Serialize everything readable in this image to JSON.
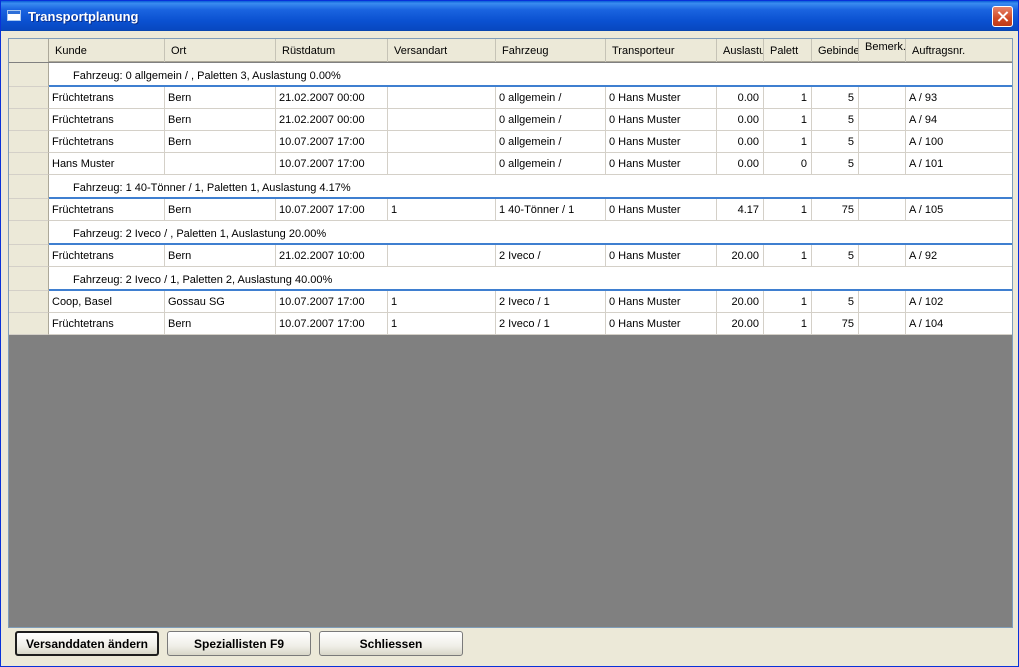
{
  "window": {
    "title": "Transportplanung"
  },
  "columns": [
    "Kunde",
    "Ort",
    "Rüstdatum",
    "Versandart",
    "Fahrzeug",
    "Transporteur",
    "Auslastu",
    "Palett",
    "Gebinde",
    "Bemerk.",
    "Auftragsnr."
  ],
  "groups": [
    {
      "header": "Fahrzeug: 0 allgemein / , Paletten 3, Auslastung 0.00%",
      "rows": [
        [
          "Früchtetrans",
          "Bern",
          "21.02.2007 00:00",
          "",
          "0 allgemein /",
          "0 Hans Muster",
          "0.00",
          "1",
          "5",
          "",
          "A / 93"
        ],
        [
          "Früchtetrans",
          "Bern",
          "21.02.2007 00:00",
          "",
          "0 allgemein /",
          "0 Hans Muster",
          "0.00",
          "1",
          "5",
          "",
          "A / 94"
        ],
        [
          "Früchtetrans",
          "Bern",
          "10.07.2007 17:00",
          "",
          "0 allgemein /",
          "0 Hans Muster",
          "0.00",
          "1",
          "5",
          "",
          "A / 100"
        ],
        [
          "Hans Muster",
          "",
          "10.07.2007 17:00",
          "",
          "0 allgemein /",
          "0 Hans Muster",
          "0.00",
          "0",
          "5",
          "",
          "A / 101"
        ]
      ]
    },
    {
      "header": "Fahrzeug: 1 40-Tönner / 1, Paletten 1, Auslastung 4.17%",
      "rows": [
        [
          "Früchtetrans",
          "Bern",
          "10.07.2007 17:00",
          "1",
          "1 40-Tönner / 1",
          "0 Hans Muster",
          "4.17",
          "1",
          "75",
          "",
          "A / 105"
        ]
      ]
    },
    {
      "header": "Fahrzeug: 2 Iveco / , Paletten 1, Auslastung 20.00%",
      "rows": [
        [
          "Früchtetrans",
          "Bern",
          "21.02.2007 10:00",
          "",
          "2 Iveco /",
          "0 Hans Muster",
          "20.00",
          "1",
          "5",
          "",
          "A / 92"
        ]
      ]
    },
    {
      "header": "Fahrzeug: 2 Iveco / 1, Paletten 2, Auslastung 40.00%",
      "rows": [
        [
          "Coop, Basel",
          "Gossau SG",
          "10.07.2007 17:00",
          "1",
          "2 Iveco / 1",
          "0 Hans Muster",
          "20.00",
          "1",
          "5",
          "",
          "A / 102"
        ],
        [
          "Früchtetrans",
          "Bern",
          "10.07.2007 17:00",
          "1",
          "2 Iveco / 1",
          "0 Hans Muster",
          "20.00",
          "1",
          "75",
          "",
          "A / 104"
        ]
      ]
    }
  ],
  "buttons": {
    "change": "Versanddaten ändern",
    "special": "Speziallisten F9",
    "close": "Schliessen"
  },
  "icons": {
    "window": "window-icon",
    "close": "close-icon"
  }
}
